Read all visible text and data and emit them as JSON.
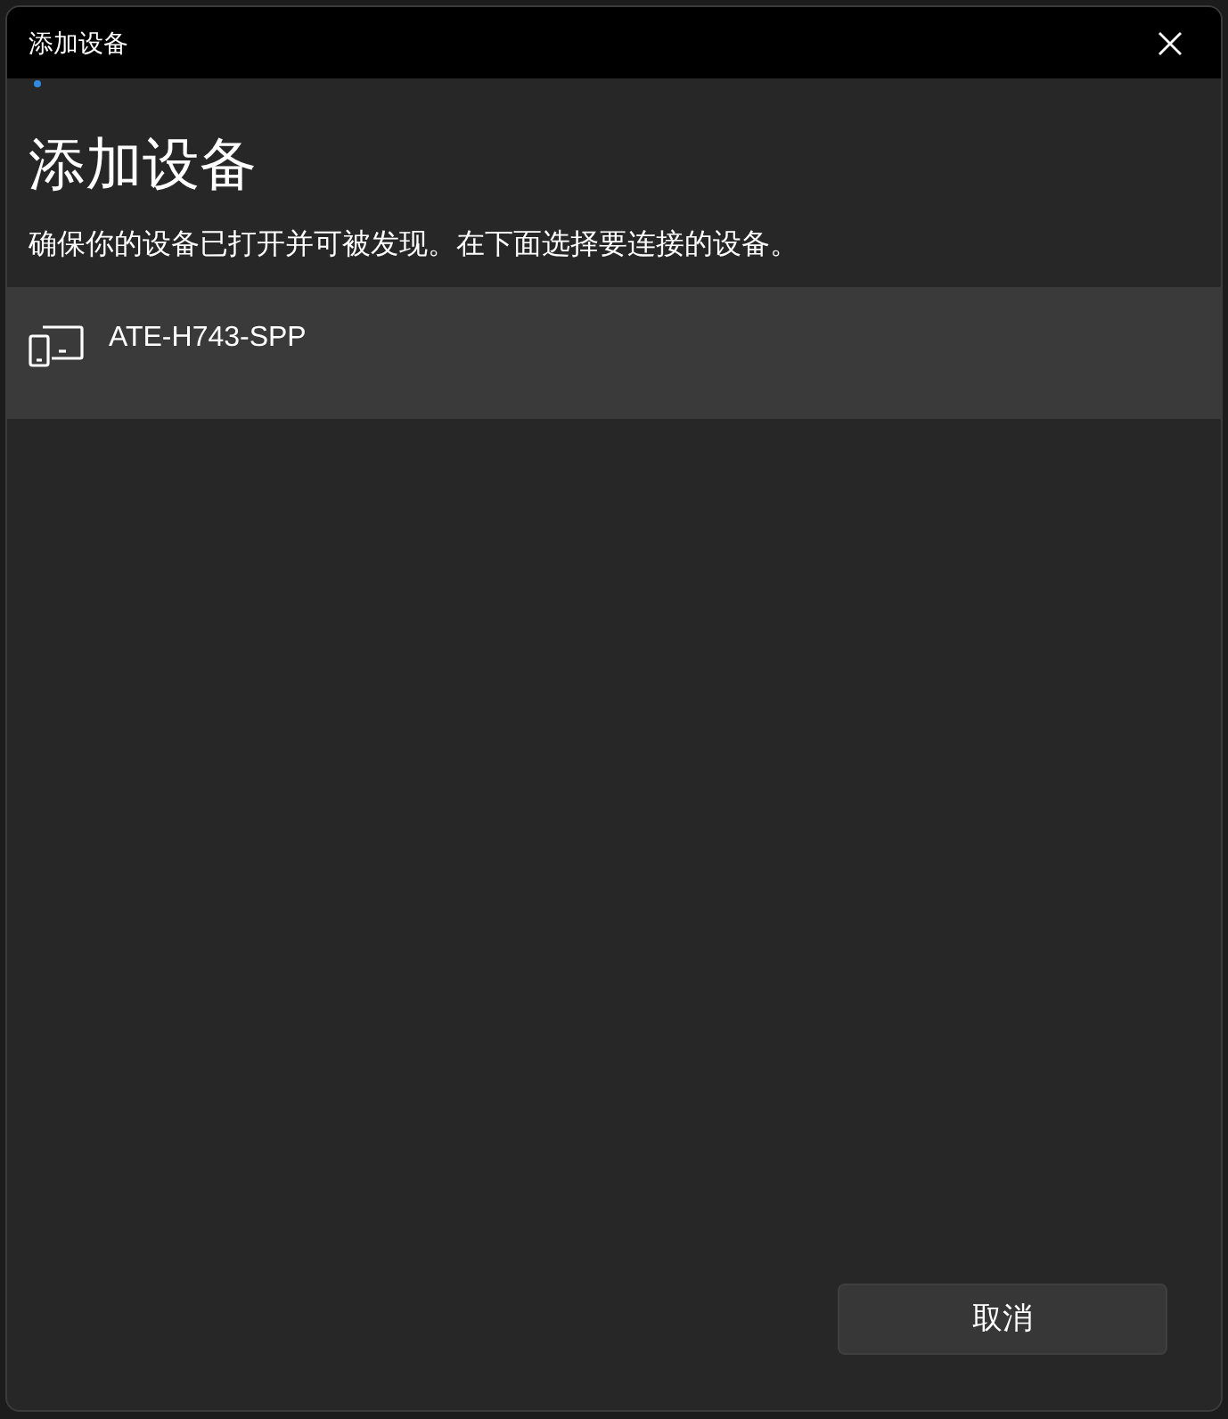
{
  "window": {
    "title": "添加设备"
  },
  "heading": "添加设备",
  "instruction": "确保你的设备已打开并可被发现。在下面选择要连接的设备。",
  "devices": [
    {
      "name": "ATE-H743-SPP",
      "selected": true
    }
  ],
  "buttons": [
    {
      "label": "取消"
    }
  ]
}
